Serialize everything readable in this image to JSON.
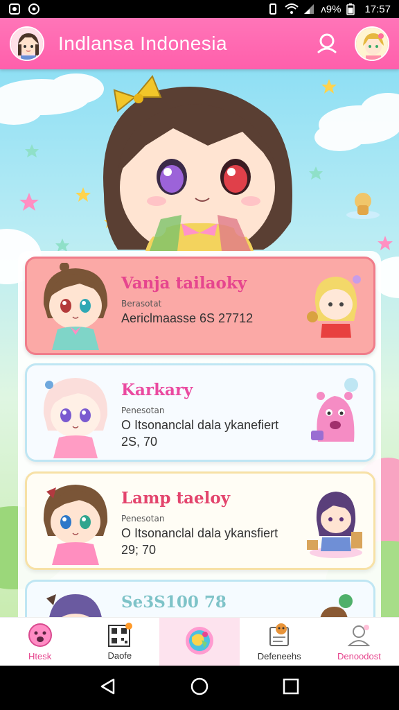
{
  "status_bar": {
    "battery": "ʌ9%",
    "time": "17:57"
  },
  "header": {
    "title": "Indlansa Indonesia"
  },
  "cards": [
    {
      "name": "Vanja tailaoky",
      "subtitle": "Berasotat",
      "description": "Aericlmaasse 6S 27712",
      "value": ""
    },
    {
      "name": "Karkary",
      "subtitle": "Penesotan",
      "description": "O Itsonanclal dala ykanefiert",
      "value": "2S, 70"
    },
    {
      "name": "Lamp taeloy",
      "subtitle": "Penesotan",
      "description": "O Itsonanclal dala ykansfiert",
      "value": "29; 70"
    },
    {
      "name": "Se3S100 78",
      "subtitle": "",
      "description": "",
      "value": ""
    }
  ],
  "bottom_nav": {
    "items": [
      {
        "label": "Htesk"
      },
      {
        "label": "Daofe"
      },
      {
        "label": ""
      },
      {
        "label": "Defeneehs"
      },
      {
        "label": "Denoodost"
      }
    ]
  },
  "colors": {
    "header": "#ff66b0",
    "card1_bg": "#fba9a6",
    "card1_title": "#e6458e",
    "card2_title": "#ea4aa0",
    "card3_title": "#e3456d",
    "nav_active_bg": "#fde3ee"
  }
}
